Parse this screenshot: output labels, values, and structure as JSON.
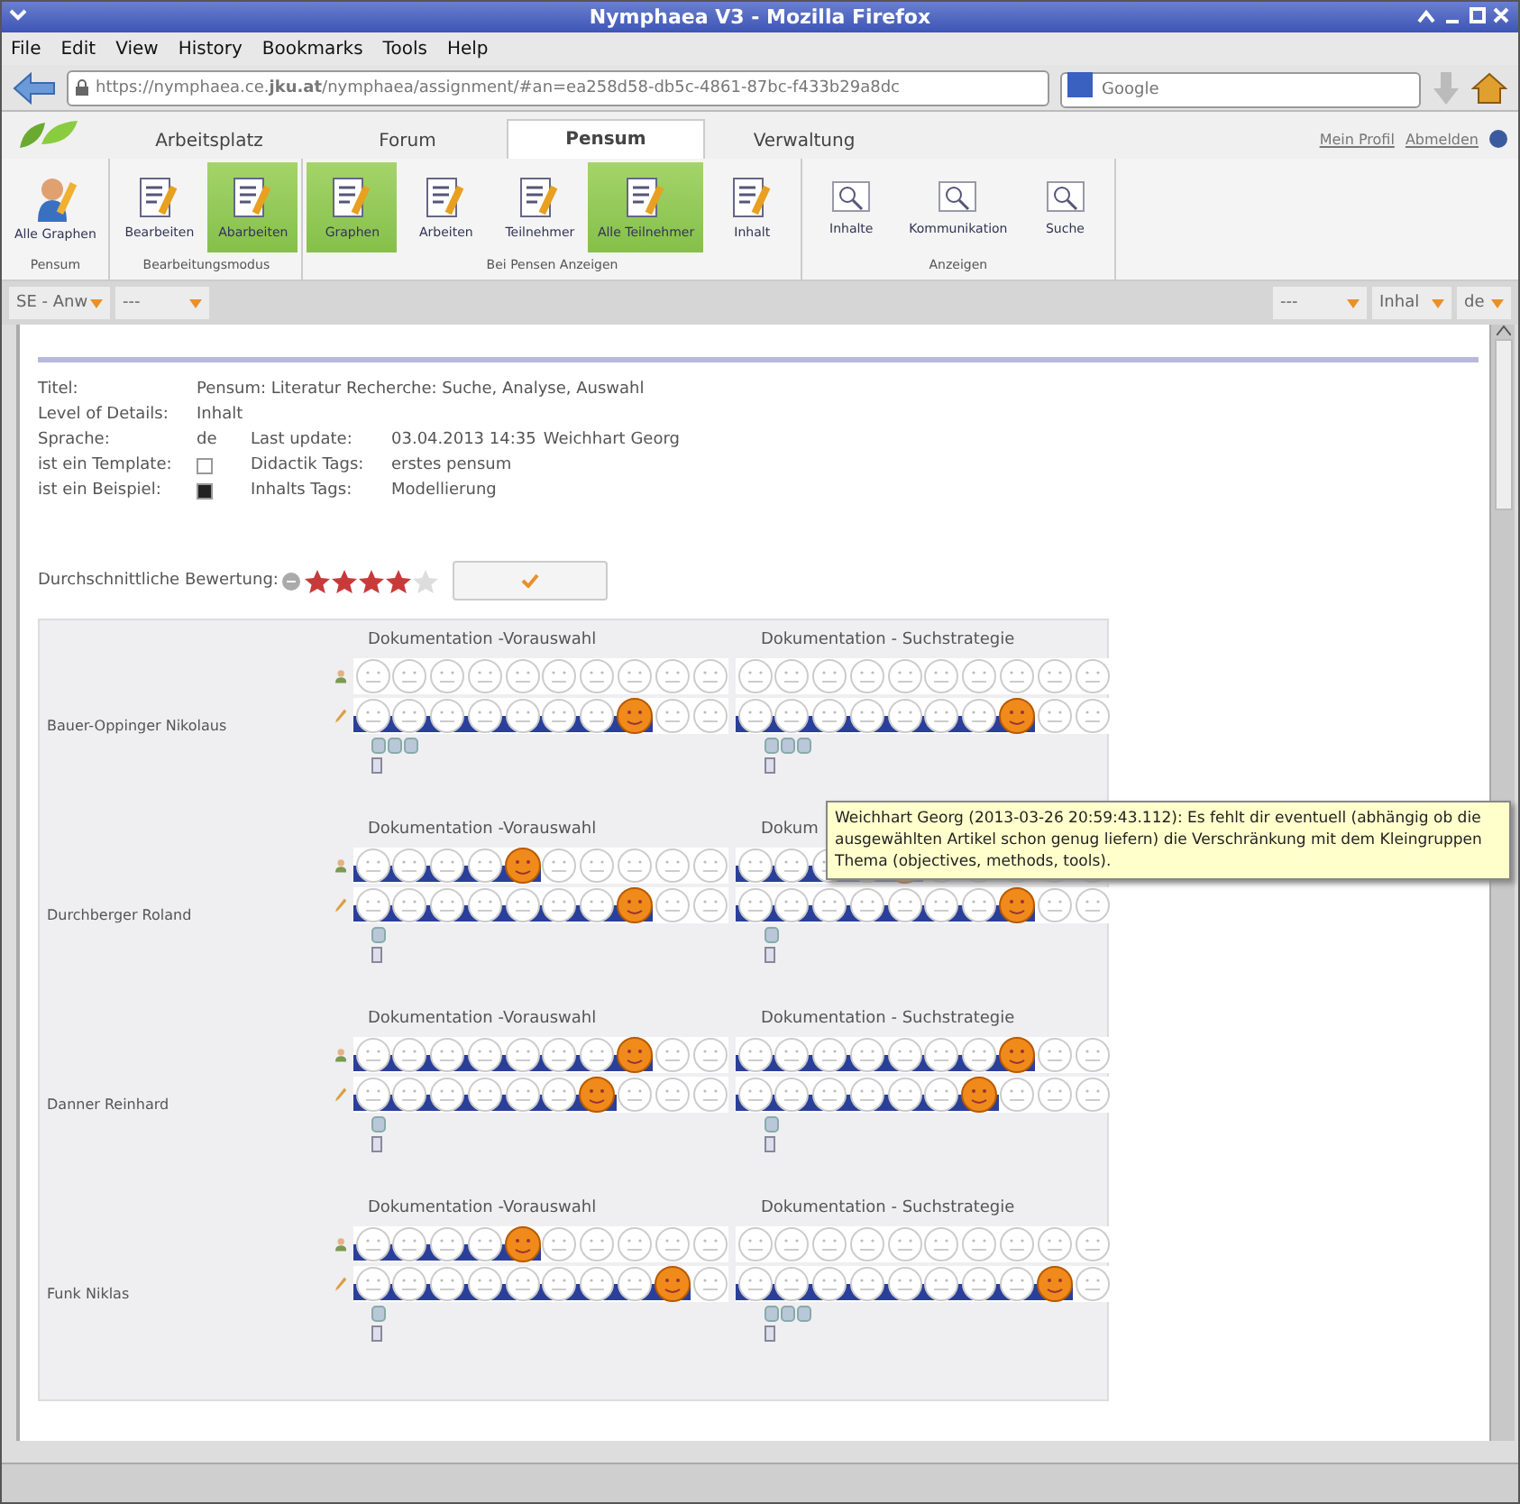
{
  "window": {
    "title": "Nymphaea V3 - Mozilla Firefox"
  },
  "menu": [
    "File",
    "Edit",
    "View",
    "History",
    "Bookmarks",
    "Tools",
    "Help"
  ],
  "address": {
    "url": "https://nymphaea.ce.**jku.at**/nymphaea/assignment/#an=ea258d58-db5c-4861-87bc-f433b29a8dc"
  },
  "search": {
    "placeholder": "Google"
  },
  "app_tabs": [
    {
      "label": "Arbeitsplatz",
      "selected": false
    },
    {
      "label": "Forum",
      "selected": false
    },
    {
      "label": "Pensum",
      "selected": true
    },
    {
      "label": "Verwaltung",
      "selected": false
    }
  ],
  "user_links": [
    "Mein Profil",
    "Abmelden"
  ],
  "ribbon": [
    {
      "label": "Pensum",
      "buttons": [
        {
          "label": "Alle Graphen",
          "kind": "person",
          "selected": false
        }
      ]
    },
    {
      "label": "Bearbeitungsmodus",
      "buttons": [
        {
          "label": "Bearbeiten",
          "kind": "doc",
          "selected": false
        },
        {
          "label": "Abarbeiten",
          "kind": "doc",
          "selected": true
        }
      ]
    },
    {
      "label": "Bei Pensen Anzeigen",
      "buttons": [
        {
          "label": "Graphen",
          "kind": "doc",
          "selected": true
        },
        {
          "label": "Arbeiten",
          "kind": "doc",
          "selected": false
        },
        {
          "label": "Teilnehmer",
          "kind": "doc",
          "selected": false
        },
        {
          "label": "Alle Teilnehmer",
          "kind": "doc",
          "selected": true
        },
        {
          "label": "Inhalt",
          "kind": "doc",
          "selected": false
        }
      ]
    },
    {
      "label": "Anzeigen",
      "buttons": [
        {
          "label": "Inhalte",
          "kind": "search",
          "selected": false
        },
        {
          "label": "Kommunikation",
          "kind": "search",
          "selected": false
        },
        {
          "label": "Suche",
          "kind": "search",
          "selected": false
        }
      ]
    }
  ],
  "filters_left": [
    "SE - Anw",
    "---"
  ],
  "filters_right": [
    "---",
    "Inhal",
    "de"
  ],
  "details": {
    "title_label": "Titel:",
    "title": "Pensum: Literatur Recherche: Suche, Analyse, Auswahl",
    "level_label": "Level of Details:",
    "level": "Inhalt",
    "language_label": "Sprache:",
    "language": "de",
    "update_label": "Last update:",
    "update": "03.04.2013 14:35",
    "author": "Weichhart Georg",
    "template_label": "ist ein Template:",
    "template_checked": false,
    "didactic_label": "Didactik Tags:",
    "didactic": "erstes pensum",
    "example_label": "ist ein Beispiel:",
    "example_checked": true,
    "content_label": "Inhalts Tags:",
    "content": "Modellierung"
  },
  "rating": {
    "label": "Durchschnittliche Bewertung:",
    "stars": 4
  },
  "students": [
    {
      "name": "Bauer-Oppinger Nikolaus",
      "tasks": [
        {
          "title": "Dokumentation -Vorauswahl",
          "ratings": [
            {
              "kind": "student"
            },
            {
              "kind": "teacher",
              "level": 0.8
            }
          ],
          "comments": [
            {
              "kind": "note"
            },
            {
              "kind": "note"
            },
            {
              "kind": "note"
            }
          ]
        },
        {
          "title": "Dokumentation - Suchstrategie",
          "ratings": [
            {
              "kind": "student"
            },
            {
              "kind": "teacher",
              "level": 0.8
            }
          ],
          "comments": [
            {
              "kind": "note"
            },
            {
              "kind": "note"
            },
            {
              "kind": "note"
            }
          ]
        }
      ]
    },
    {
      "name": "Durchberger Roland",
      "tasks": [
        {
          "title": "Dokumentation -Vorauswahl",
          "ratings": [
            {
              "kind": "student",
              "level": 0.5
            },
            {
              "kind": "teacher",
              "level": 0.8
            }
          ],
          "comments": [
            {
              "kind": "note"
            }
          ]
        },
        {
          "title": "Dokum",
          "ratings": [
            {
              "kind": "student",
              "level": 0.5
            },
            {
              "kind": "teacher",
              "level": 0.8
            }
          ],
          "comments": [
            {
              "kind": "note"
            }
          ]
        }
      ]
    },
    {
      "name": "Danner Reinhard",
      "tasks": [
        {
          "title": "Dokumentation -Vorauswahl",
          "ratings": [
            {
              "kind": "student",
              "level": 0.8
            },
            {
              "kind": "teacher",
              "level": 0.7
            }
          ],
          "comments": [
            {
              "kind": "note"
            }
          ]
        },
        {
          "title": "Dokumentation - Suchstrategie",
          "ratings": [
            {
              "kind": "student",
              "level": 0.8
            },
            {
              "kind": "teacher",
              "level": 0.7
            }
          ],
          "comments": [
            {
              "kind": "note"
            }
          ]
        }
      ]
    },
    {
      "name": "Funk Niklas",
      "tasks": [
        {
          "title": "Dokumentation -Vorauswahl",
          "ratings": [
            {
              "kind": "student",
              "level": 0.5
            },
            {
              "kind": "teacher",
              "level": 0.9
            }
          ],
          "comments": [
            {
              "kind": "note"
            }
          ]
        },
        {
          "title": "Dokumentation - Suchstrategie",
          "ratings": [
            {
              "kind": "student"
            },
            {
              "kind": "teacher",
              "level": 0.9
            }
          ],
          "comments": [
            {
              "kind": "note"
            },
            {
              "kind": "note"
            },
            {
              "kind": "note"
            }
          ]
        }
      ]
    }
  ],
  "tooltip": "Weichhart Georg (2013-03-26 20:59:43.112): Es fehlt dir eventuell (abhängig ob die ausgewählten Artikel schon genug liefern) die Verschränkung mit dem Kleingruppen Thema (objectives, methods, tools)."
}
